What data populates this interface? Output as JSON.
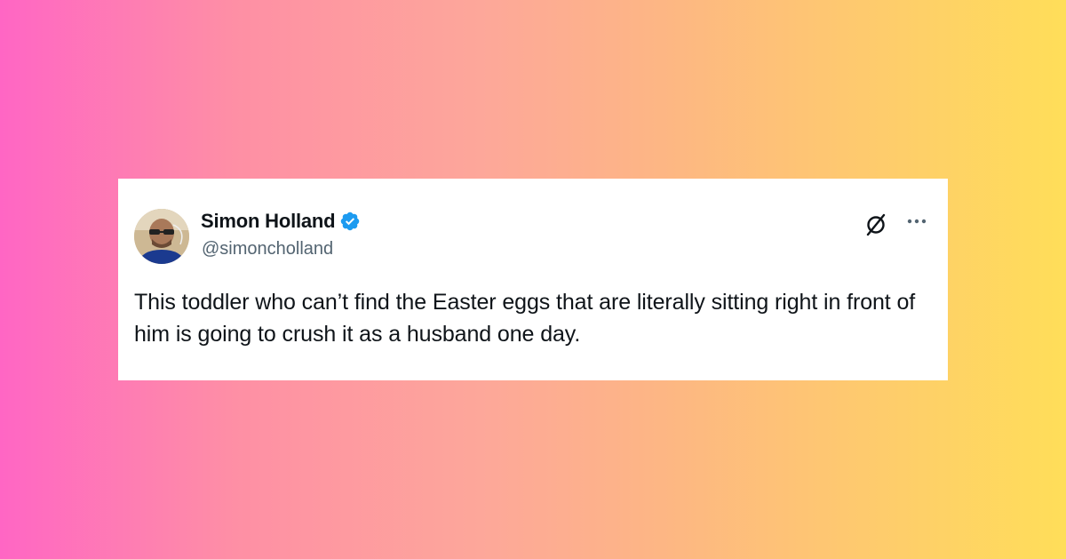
{
  "tweet": {
    "author": {
      "display_name": "Simon Holland",
      "handle": "@simoncholland",
      "verified": true,
      "avatar_icon": "avatar-photo"
    },
    "text": "This toddler who can’t find the Easter eggs that are literally sitting right in front of him is going to crush it as a husband one day.",
    "actions": {
      "grok_icon": "grok-icon",
      "more_icon": "more-icon"
    }
  },
  "colors": {
    "background_gradient_start": "#ff66c4",
    "background_gradient_end": "#ffde59",
    "card": "#ffffff",
    "text_primary": "#0f1419",
    "text_secondary": "#536471",
    "verified_blue": "#1d9bf0"
  }
}
